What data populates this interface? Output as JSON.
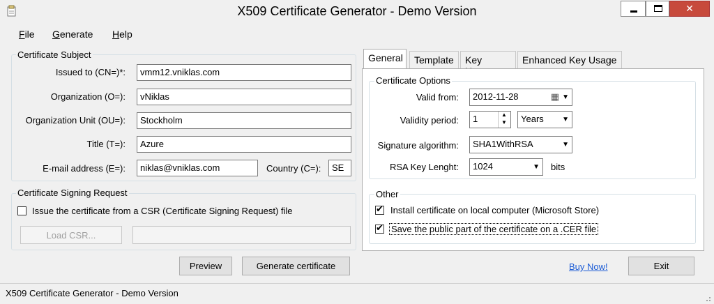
{
  "window": {
    "title": "X509 Certificate Generator - Demo Version",
    "controls": {
      "minimize": "▁",
      "maximize": "▭",
      "close": "✕"
    }
  },
  "menu": [
    {
      "key": "F",
      "rest": "ile"
    },
    {
      "key": "G",
      "rest": "enerate"
    },
    {
      "key": "H",
      "rest": "elp"
    }
  ],
  "subject": {
    "legend": "Certificate Subject",
    "issued_to_label": "Issued to (CN=)*:",
    "issued_to_value": "vmm12.vniklas.com",
    "organization_label": "Organization (O=):",
    "organization_value": "vNiklas",
    "org_unit_label": "Organization Unit (OU=):",
    "org_unit_value": "Stockholm",
    "title_label": "Title (T=):",
    "title_value": "Azure",
    "email_label": "E-mail address (E=):",
    "email_value": "niklas@vniklas.com",
    "country_label": "Country (C=):",
    "country_value": "SE"
  },
  "csr": {
    "legend": "Certificate Signing Request",
    "checkbox_label": "Issue the certificate from a CSR (Certificate Signing Request) file",
    "checked": false,
    "load_button": "Load CSR...",
    "file_value": ""
  },
  "buttons": {
    "preview": "Preview",
    "generate": "Generate certificate",
    "buy": "Buy Now!",
    "exit": "Exit"
  },
  "tabs": [
    {
      "label": "General",
      "active": true
    },
    {
      "label": "Template",
      "active": false
    },
    {
      "label": "Key Usage",
      "active": false
    },
    {
      "label": "Enhanced Key Usage",
      "active": false
    }
  ],
  "options": {
    "legend": "Certificate Options",
    "valid_from_label": "Valid from:",
    "valid_from_value": "2012-11-28",
    "validity_label": "Validity period:",
    "validity_value": "1",
    "validity_unit": "Years",
    "sig_label": "Signature algorithm:",
    "sig_value": "SHA1WithRSA",
    "rsa_label": "RSA Key Lenght:",
    "rsa_value": "1024",
    "rsa_unit": "bits"
  },
  "other": {
    "legend": "Other",
    "install_label": "Install certificate on local computer (Microsoft Store)",
    "install_checked": true,
    "save_label": "Save the public part of the certificate on a .CER file",
    "save_checked": true
  },
  "status": {
    "text": "X509 Certificate Generator - Demo Version"
  },
  "icons": {
    "check": "✔",
    "dropdown": "▼",
    "spin_up": "▲",
    "spin_down": "▼",
    "calendar": "▦"
  }
}
